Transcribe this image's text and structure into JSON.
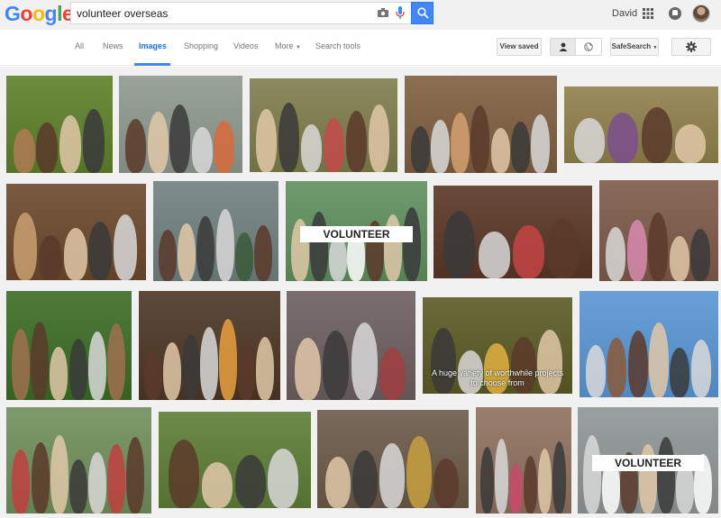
{
  "logo": [
    "G",
    "o",
    "o",
    "g",
    "l",
    "e"
  ],
  "search": {
    "query": "volunteer overseas"
  },
  "account": {
    "name": "David"
  },
  "tabs": [
    {
      "label": "All"
    },
    {
      "label": "News"
    },
    {
      "label": "Images"
    },
    {
      "label": "Shopping"
    },
    {
      "label": "Videos"
    },
    {
      "label": "More"
    },
    {
      "label": "Search tools"
    }
  ],
  "toolbar": {
    "view_saved": "View saved",
    "safesearch": "SafeSearch"
  },
  "results": [
    {
      "bg": "#6d8c3e",
      "fg": "#b07a55"
    },
    {
      "bg": "#9aa39a",
      "fg": "#d86a3a"
    },
    {
      "bg": "#8a8a5c",
      "fg": "#c24a4a"
    },
    {
      "bg": "#8c6e52",
      "fg": "#d4a070"
    },
    {
      "bg": "#9b8c5e",
      "fg": "#7b4f8c"
    },
    {
      "bg": "#7a5a40",
      "fg": "#c9a070"
    },
    {
      "bg": "#7e8c8c",
      "fg": "#3a5a3a"
    },
    {
      "bg": "#6e9a6e",
      "fg": "#ffffff",
      "text": "VOLUNTEER"
    },
    {
      "bg": "#6a4a3a",
      "fg": "#c44444"
    },
    {
      "bg": "#8a6a5a",
      "fg": "#d88ab0"
    },
    {
      "bg": "#4e7a3a",
      "fg": "#a07050"
    },
    {
      "bg": "#5e4a3a",
      "fg": "#e8a040"
    },
    {
      "bg": "#7a6e6e",
      "fg": "#a04040"
    },
    {
      "bg": "#6a6a3a",
      "fg": "#e0b040",
      "text": "A huge variety of worthwhile projects to choose from"
    },
    {
      "bg": "#6aa0d8",
      "fg": "#8a5a3a"
    },
    {
      "bg": "#7e9a6a",
      "fg": "#c04040"
    },
    {
      "bg": "#6e8a4a",
      "fg": "#2a3a6a"
    },
    {
      "bg": "#7a6a5a",
      "fg": "#c8a040"
    },
    {
      "bg": "#9a7e6e",
      "fg": "#c84a6a"
    },
    {
      "bg": "#9aa0a0",
      "fg": "#ffffff",
      "text": "VOLUNTEER"
    }
  ]
}
